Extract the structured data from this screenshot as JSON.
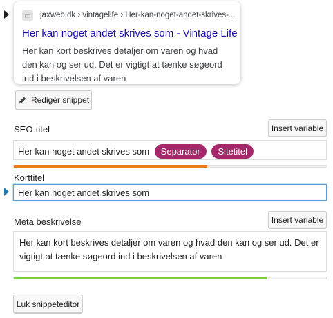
{
  "preview": {
    "favicon_icon": "favicon-placeholder-icon",
    "breadcrumb": "jaxweb.dk › vintagelife › Her-kan-noget-andet-skrives-...",
    "title": "Her kan noget andet skrives som - Vintage Life",
    "description": "Her kan kort beskrives detaljer om varen og hvad den kan og ser ud. Det er vigtigt at tænke søgeord ind i beskrivelsen af varen"
  },
  "edit_snippet_label": "Redigér snippet",
  "seo_title": {
    "label": "SEO-titel",
    "insert_variable_label": "Insert variable",
    "text": "Her kan noget andet skrives som",
    "variables": [
      "Separator",
      "Sitetitel"
    ],
    "progress_percent": 62,
    "progress_color": "#ee7c1b"
  },
  "slug": {
    "label": "Korttitel",
    "value": "Her kan noget andet skrives som"
  },
  "meta_description": {
    "label": "Meta beskrivelse",
    "insert_variable_label": "Insert variable",
    "text": "Her kan kort beskrives detaljer om varen og hvad den kan og ser ud. Det er vigtigt at tænke søgeord ind i beskrivelsen af varen",
    "progress_percent": 81,
    "progress_color": "#7ad03a"
  },
  "close_editor_label": "Luk snippeteditor"
}
